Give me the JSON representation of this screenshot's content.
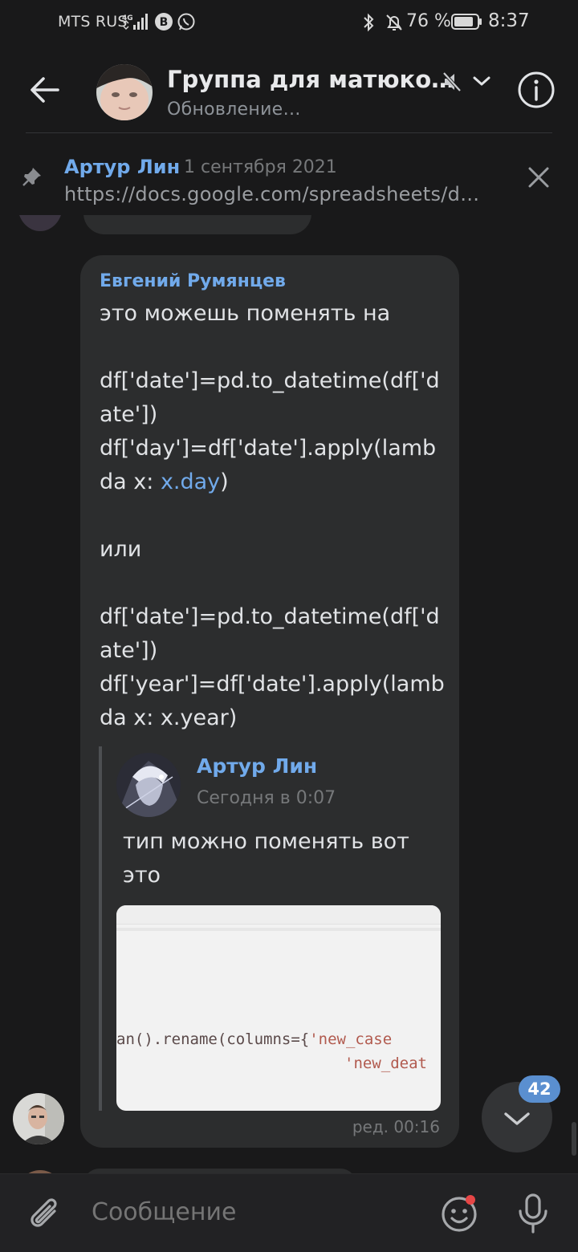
{
  "status_bar": {
    "carrier": "MTS RUS",
    "network": "4G",
    "battery_percent": "76 %",
    "time": "8:37"
  },
  "header": {
    "title": "Группа для матюко…",
    "subtitle": "Обновление…",
    "icons": [
      "back-arrow-icon",
      "mute-icon",
      "chevron-down-icon",
      "info-icon"
    ]
  },
  "pinned": {
    "author": "Артур Лин",
    "date": "1 сентября 2021",
    "text": "https://docs.google.com/spreadsheets/d…"
  },
  "message": {
    "author": "Евгений Румянцев",
    "lines": [
      "это можешь поменять на",
      "",
      "df['date']=pd.to_datetime(df['d",
      "ate'])",
      "df['day']=df['date'].apply(lamb",
      "",
      "",
      "или",
      "",
      "df['date']=pd.to_datetime(df['d",
      "ate'])",
      "df['year']=df['date'].apply(lamb",
      "da x: x.year)"
    ],
    "line6_prefix": "da x: ",
    "line6_link": "x.day",
    "line6_suffix": ")",
    "edited": "ред. 00:16"
  },
  "reply": {
    "author": "Артур Лин",
    "time": "Сегодня в 0:07",
    "text": "тип можно поменять вот это",
    "image_code_line1_a": "an().rename(columns={",
    "image_code_line1_b": "'new_case",
    "image_code_line2": "'new_deat"
  },
  "scroll": {
    "unread_count": "42"
  },
  "composer": {
    "placeholder": "Сообщение"
  },
  "colors": {
    "accent": "#71aaeb",
    "background": "#19191a",
    "bubble": "#2c2d2e",
    "badge": "#5a8fd0",
    "notification_dot": "#e64646"
  }
}
